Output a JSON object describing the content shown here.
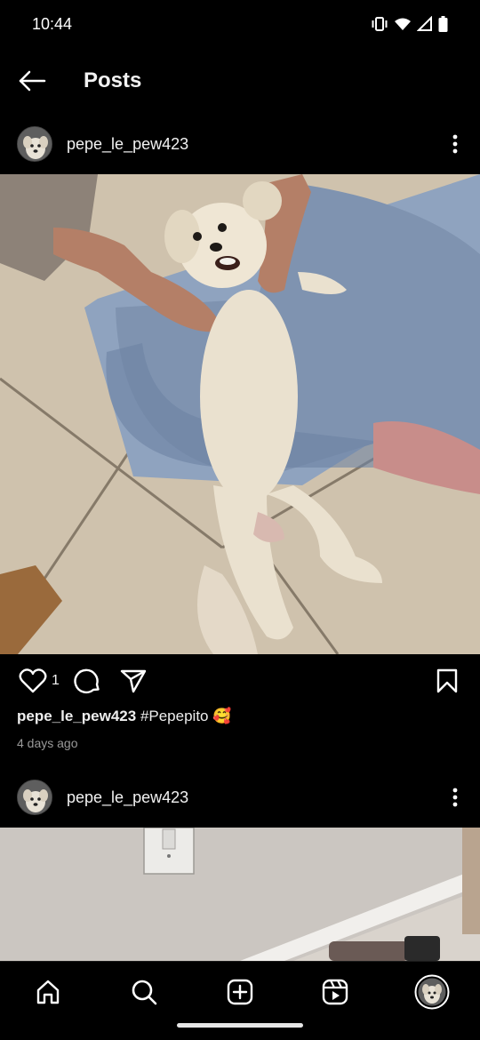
{
  "status_bar": {
    "time": "10:44"
  },
  "header": {
    "title": "Posts"
  },
  "posts": [
    {
      "username": "pepe_le_pew423",
      "like_count": "1",
      "caption_user": "pepe_le_pew423",
      "caption_text": "#Pepepito 🥰",
      "time_ago": "4 days ago"
    },
    {
      "username": "pepe_le_pew423"
    }
  ],
  "icons": {
    "back": "arrow-left-icon",
    "more": "more-vertical-icon",
    "like": "heart-icon",
    "comment": "comment-icon",
    "share": "send-icon",
    "save": "bookmark-icon",
    "nav": [
      "home-icon",
      "search-icon",
      "add-post-icon",
      "reels-icon",
      "profile-avatar"
    ]
  },
  "colors": {
    "background": "#000000",
    "text": "#ffffff",
    "secondary_text": "#9a9a9a"
  }
}
